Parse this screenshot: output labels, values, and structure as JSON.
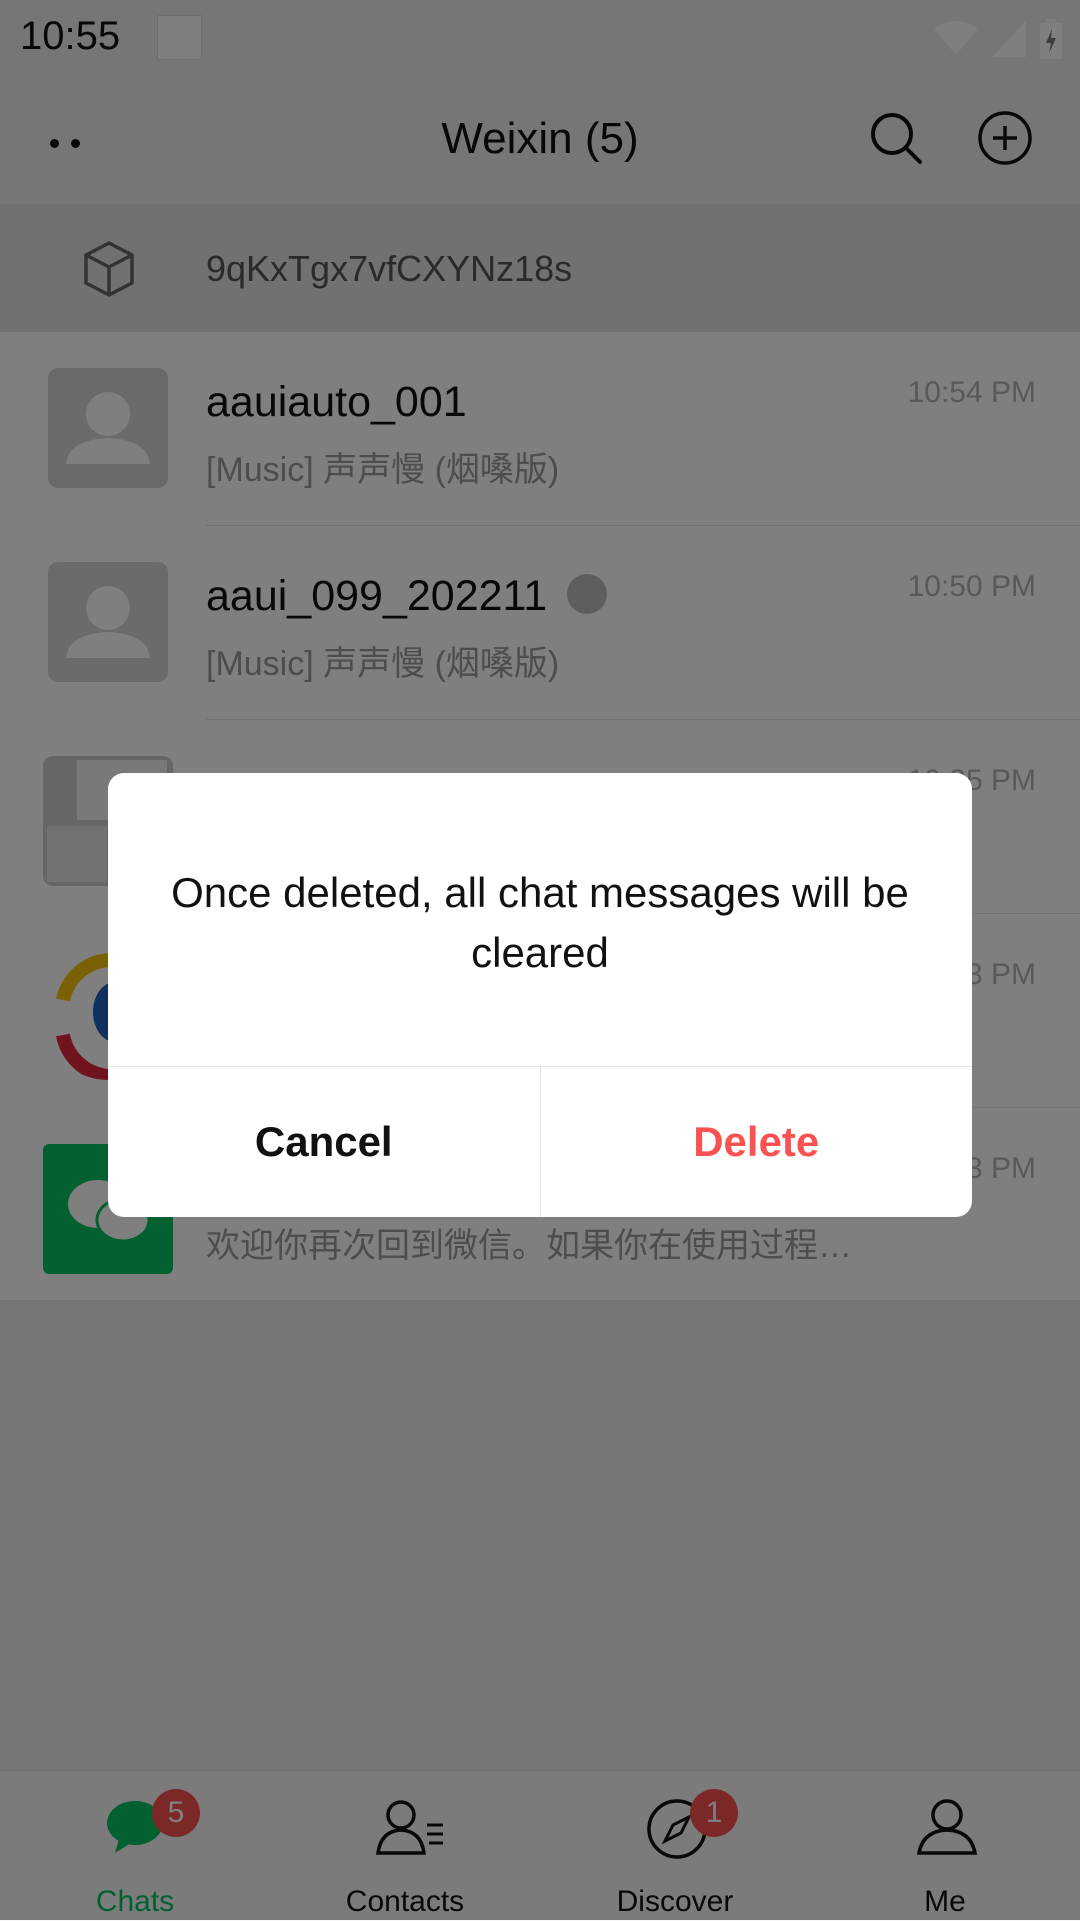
{
  "status_bar": {
    "time": "10:55"
  },
  "header": {
    "title": "Weixin (5)"
  },
  "device_banner": {
    "text": "9qKxTgx7vfCXYNz18s"
  },
  "chats": [
    {
      "name": "aauiauto_001",
      "preview": "[Music] 声声慢 (烟嗓版)",
      "time": "10:54 PM"
    },
    {
      "name": "aaui_099_202211",
      "preview": "[Music] 声声慢 (烟嗓版)",
      "time": "10:50 PM"
    },
    {
      "name": "",
      "preview": "",
      "time": "10:25 PM"
    },
    {
      "name": "",
      "preview": "",
      "time": "…3 PM"
    },
    {
      "name": "",
      "preview": "欢迎你再次回到微信。如果你在使用过程…",
      "time": "…3 PM"
    }
  ],
  "dialog": {
    "message": "Once deleted, all chat messages will be cleared",
    "cancel_label": "Cancel",
    "delete_label": "Delete"
  },
  "bottom_nav": {
    "items": [
      {
        "label": "Chats",
        "badge": "5"
      },
      {
        "label": "Contacts"
      },
      {
        "label": "Discover",
        "badge": "1"
      },
      {
        "label": "Me"
      }
    ]
  },
  "colors": {
    "accent": "#07c160",
    "danger": "#fa5151",
    "badge": "#fa5151"
  }
}
